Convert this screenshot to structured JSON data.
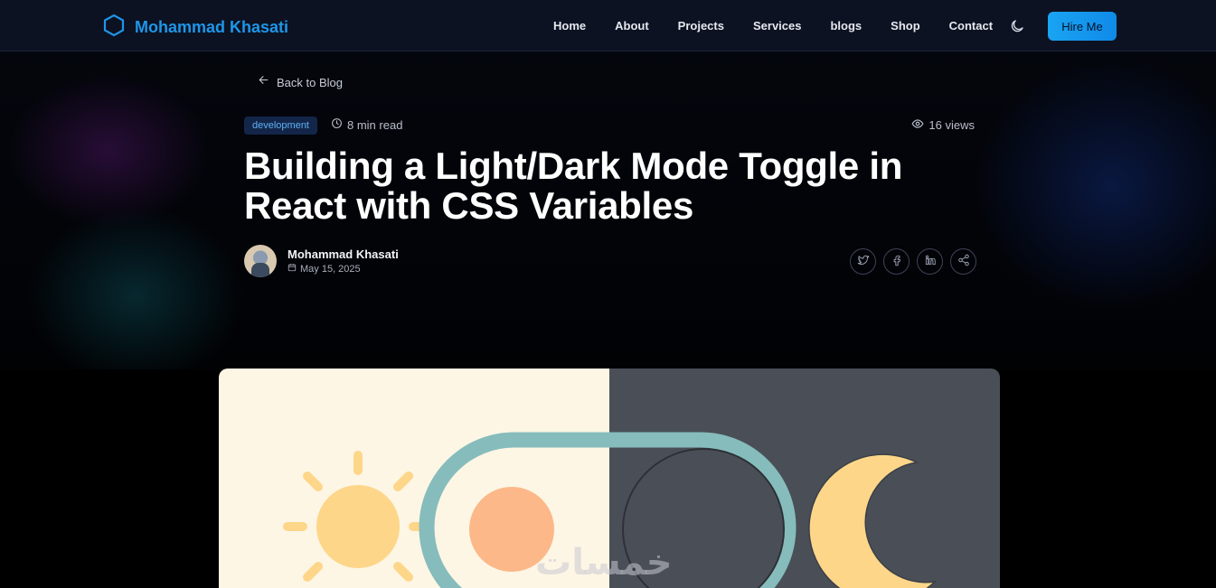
{
  "nav": {
    "brand": "Mohammad Khasati",
    "links": [
      "Home",
      "About",
      "Projects",
      "Services",
      "blogs",
      "Shop",
      "Contact"
    ],
    "hire_label": "Hire Me"
  },
  "post": {
    "back_label": "Back to Blog",
    "category": "development",
    "read_time": "8 min read",
    "views": "16 views",
    "title": "Building a Light/Dark Mode Toggle in React with CSS Variables",
    "author_name": "Mohammad Khasati",
    "date": "May 15, 2025"
  },
  "share_icons": [
    "twitter-icon",
    "facebook-icon",
    "linkedin-icon",
    "share-icon"
  ],
  "watermark": "خمسات",
  "colors": {
    "accent": "#1e96e8",
    "tag_bg": "#13264a",
    "tag_text": "#5fb1f5",
    "light_panel": "#fdf6e4",
    "dark_panel": "#4a4f57",
    "toggle_track": "#86bcbc",
    "sun": "#fdd68a",
    "knob": "#fcb888"
  }
}
